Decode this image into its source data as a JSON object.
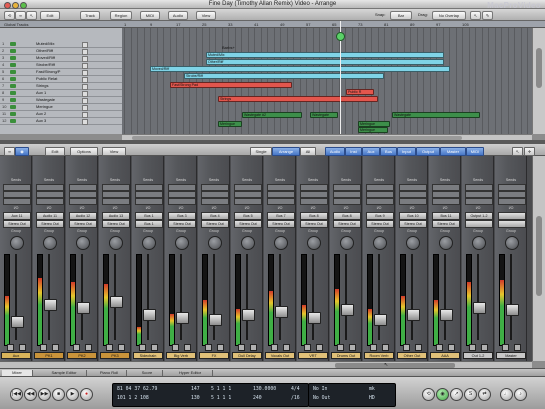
{
  "window": {
    "title": "Fine Day (Timothy Allan Remix) Video - Arrange"
  },
  "watermark": "MacProVideo",
  "toolbar": {
    "menus": [
      "Edit",
      "Track",
      "Region",
      "MIDI",
      "Audio",
      "View"
    ],
    "snap_label": "Snap:",
    "snap_value": "Bar",
    "drag_label": "Drag:",
    "drag_value": "No Overlap"
  },
  "arrange": {
    "global_tracks_label": "Global Tracks",
    "ruler": [
      "1",
      "9",
      "17",
      "25",
      "33",
      "41",
      "49",
      "57",
      "65",
      "73",
      "81",
      "89",
      "97",
      "105"
    ],
    "marker_label": "Barbs+",
    "tracks": [
      {
        "num": "1",
        "name": "Muted/Mix"
      },
      {
        "num": "2",
        "name": "Other/Riff"
      },
      {
        "num": "3",
        "name": "Moved/Riff"
      },
      {
        "num": "4",
        "name": "Strobe/Riff"
      },
      {
        "num": "5",
        "name": "Fast/Strong/P"
      },
      {
        "num": "6",
        "name": "Public Relat"
      },
      {
        "num": "7",
        "name": "Strings"
      },
      {
        "num": "8",
        "name": "Aux 1"
      },
      {
        "num": "9",
        "name": "Wastegate"
      },
      {
        "num": "10",
        "name": "Meringue"
      },
      {
        "num": "11",
        "name": "Aux 2"
      },
      {
        "num": "12",
        "name": "Aux 3"
      }
    ],
    "regions": [
      {
        "label": "Muted/Mix",
        "color": "#7fd3e6"
      },
      {
        "label": "Other/Riff",
        "color": "#7fd3e6"
      },
      {
        "label": "Moved/Riff",
        "color": "#7fd3e6"
      },
      {
        "label": "Strobe/Riff",
        "color": "#7fd3e6"
      },
      {
        "label": "Fast/Strong Pad",
        "color": "#e2564d"
      },
      {
        "label": "Public R",
        "color": "#e2564d"
      },
      {
        "label": "Strings",
        "color": "#e2564d"
      },
      {
        "label": "Wastegate #2",
        "color": "#3d8f4a"
      },
      {
        "label": "Wastegate",
        "color": "#3d8f4a"
      },
      {
        "label": "Wastegate",
        "color": "#3d8f4a"
      },
      {
        "label": "Meringue",
        "color": "#3d8f4a"
      },
      {
        "label": "Meringue",
        "color": "#3d8f4a"
      },
      {
        "label": "Meringue",
        "color": "#3d8f4a"
      }
    ]
  },
  "mixer_toolbar": {
    "left": [
      "Edit",
      "Options",
      "View"
    ],
    "mode": [
      "Single",
      "Arrange",
      "All"
    ],
    "filters": [
      "Audio",
      "Inst",
      "Aux",
      "Bus",
      "Input",
      "Output",
      "Master",
      "MIDI"
    ]
  },
  "mixer": {
    "sends_label": "Sends",
    "io_label": "I/O",
    "group_label": "Group",
    "strips": [
      {
        "input": "Aux 11",
        "output": "Stereo Out",
        "name": "Aux",
        "name_color": "#d9b45a"
      },
      {
        "input": "Audio 11",
        "output": "Stereo Out",
        "name": "PK1",
        "name_color": "#c9933a"
      },
      {
        "input": "Audio 12",
        "output": "Stereo Out",
        "name": "PK2",
        "name_color": "#c9933a"
      },
      {
        "input": "Audio 13",
        "output": "Stereo Out",
        "name": "PK3",
        "name_color": "#c9933a"
      },
      {
        "input": "Bus 1",
        "output": "Bus 1",
        "name": "Sidechain",
        "name_color": "#e0c078"
      },
      {
        "input": "Bus 3",
        "output": "Stereo Out",
        "name": "Big Verb",
        "name_color": "#e0c078"
      },
      {
        "input": "Bus 4",
        "output": "Stereo Out",
        "name": "FX",
        "name_color": "#e0c078"
      },
      {
        "input": "Bus 5",
        "output": "Stereo Out",
        "name": "Dull Delay",
        "name_color": "#e0c078"
      },
      {
        "input": "Bus 7",
        "output": "Stereo Out",
        "name": "Vocals Out",
        "name_color": "#e0c078"
      },
      {
        "input": "Bus 8",
        "output": "Stereo Out",
        "name": "VRT",
        "name_color": "#e0c078"
      },
      {
        "input": "Bus 8",
        "output": "Stereo Out",
        "name": "Drums Out",
        "name_color": "#e0c078"
      },
      {
        "input": "Bus 9",
        "output": "Stereo Out",
        "name": "Room Verb",
        "name_color": "#e0c078"
      },
      {
        "input": "Bus 10",
        "output": "Stereo Out",
        "name": "Other Out",
        "name_color": "#e0c078"
      },
      {
        "input": "Bus 11",
        "output": "Stereo Out",
        "name": "AAA",
        "name_color": "#e0c078"
      },
      {
        "input": "Output 1-2",
        "output": "",
        "name": "Out 1-2",
        "name_color": "#c8c8c8"
      },
      {
        "input": "",
        "output": "",
        "name": "Master",
        "name_color": "#c8c8c8"
      }
    ]
  },
  "bottom_tabs": [
    "Mixer",
    "Sample Editor",
    "Piano Roll",
    "Score",
    "Hyper Editor"
  ],
  "transport": {
    "buttons": [
      "|◀◀",
      "◀◀",
      "▶▶",
      "■",
      "▶",
      "●"
    ],
    "position_line1": "81 04 37 62.79",
    "position_line2": "101 1 2 108",
    "tempo_line1": "147",
    "tempo_line2": "130",
    "sig_line1": "5 1 1 1",
    "sig_line2": "5 1 1 1",
    "tempo": "130.0000",
    "tempo2": "240",
    "timesig": "4/4",
    "division": "/16",
    "in_label": "No In",
    "out_label": "No Out",
    "cpu_label": "mk",
    "hd_label": "HD"
  }
}
